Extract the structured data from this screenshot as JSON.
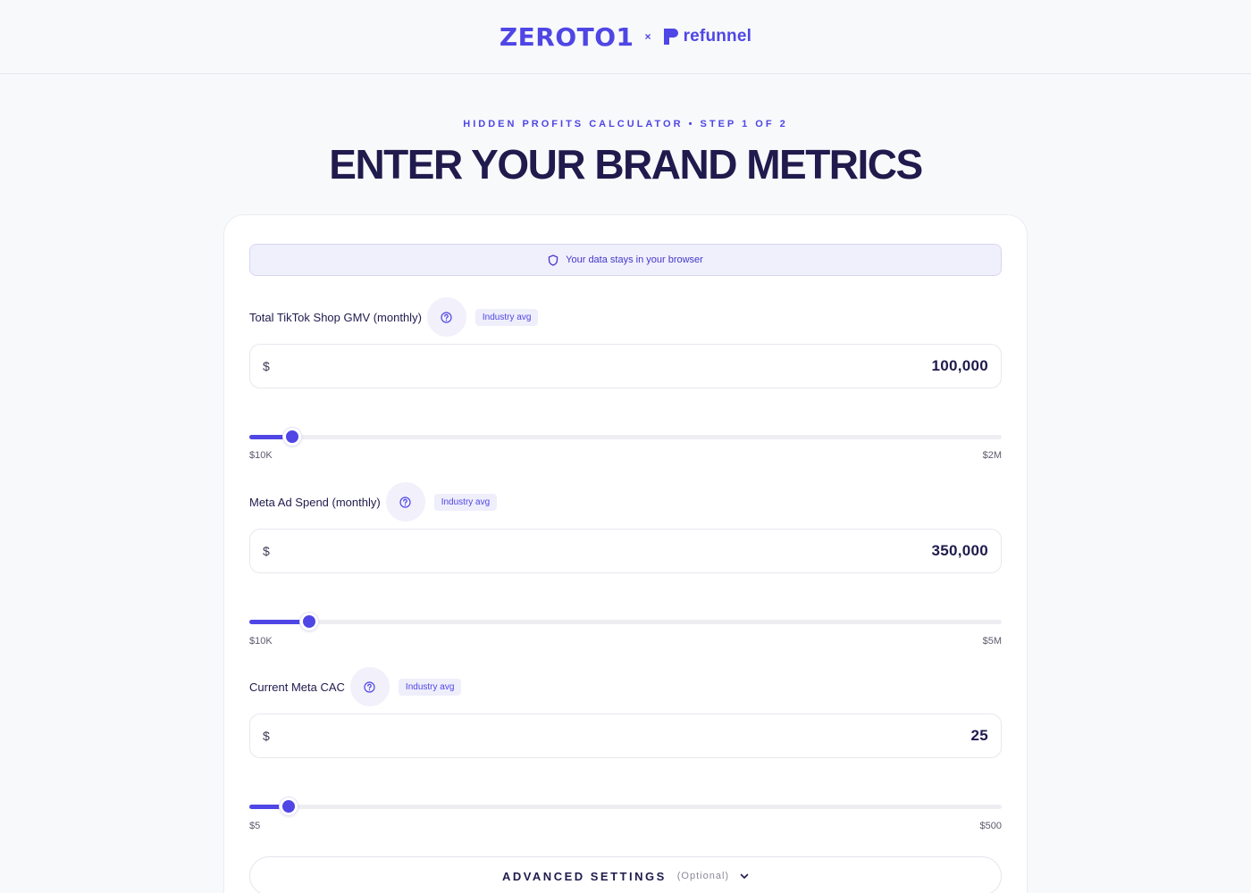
{
  "header": {
    "brand_primary": "ZEROTO1",
    "separator": "×",
    "brand_secondary": "refunnel"
  },
  "hero": {
    "eyebrow": "HIDDEN PROFITS CALCULATOR • STEP 1 OF 2",
    "title": "ENTER YOUR BRAND METRICS"
  },
  "privacy_note": "Your data stays in your browser",
  "fields": [
    {
      "label": "Total TikTok Shop GMV (monthly)",
      "badge": "Industry avg",
      "currency": "$",
      "value": "100,000",
      "slider_fraction": 0.057,
      "range_min": "$10K",
      "range_max": "$2M"
    },
    {
      "label": "Meta Ad Spend (monthly)",
      "badge": "Industry avg",
      "currency": "$",
      "value": "350,000",
      "slider_fraction": 0.08,
      "range_min": "$10K",
      "range_max": "$5M"
    },
    {
      "label": "Current Meta CAC",
      "badge": "Industry avg",
      "currency": "$",
      "value": "25",
      "slider_fraction": 0.052,
      "range_min": "$5",
      "range_max": "$500"
    }
  ],
  "advanced": {
    "label": "ADVANCED SETTINGS",
    "optional": "(Optional)"
  },
  "colors": {
    "accent": "#4f46e5",
    "heading": "#1f1b4d",
    "background": "#f8f9fb"
  },
  "icons": [
    "shield-icon",
    "help-circle-icon",
    "chevron-down-icon",
    "refunnel-logo-icon"
  ]
}
